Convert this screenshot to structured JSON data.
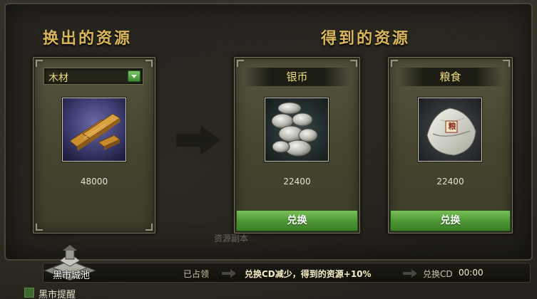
{
  "headings": {
    "give": "换出的资源",
    "get": "得到的资源"
  },
  "give_panel": {
    "selected_resource": "木材",
    "dropdown_icon": "chevron-down-icon",
    "amount": "48000",
    "image_icon": "wood-planks-icon"
  },
  "receive_panels": [
    {
      "title": "银币",
      "amount": "22400",
      "image_icon": "silver-coins-icon",
      "button_label": "兑换"
    },
    {
      "title": "粮食",
      "amount": "22400",
      "image_icon": "grain-sack-icon",
      "sack_stamp": "粮",
      "button_label": "兑换"
    }
  ],
  "background_text": "资源副本",
  "bottom_bar": {
    "city_name": "黑市城池",
    "occupied_label": "已占领",
    "benefit_text": "兑换CD减少，得到的资源+10%",
    "cd_label": "兑换CD",
    "cd_time": "00:00"
  },
  "reminder": {
    "label": "黑市提醒"
  },
  "colors": {
    "heading_gold": "#d9b65a",
    "resource_title_yellow": "#f0dd7a",
    "button_green": "#4f9836",
    "panel_bg": "#4a4a35"
  }
}
